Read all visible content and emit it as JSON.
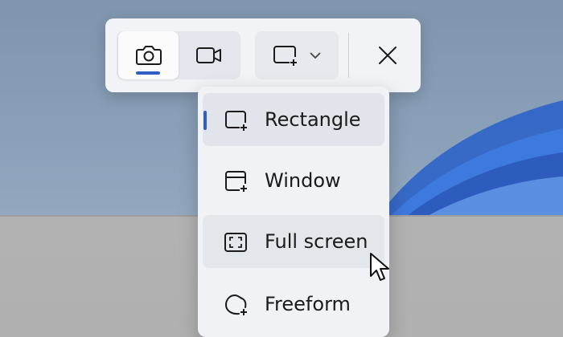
{
  "toolbar": {
    "modes": [
      {
        "name": "screenshot",
        "icon": "camera-icon",
        "active": true
      },
      {
        "name": "record",
        "icon": "video-camera-icon",
        "active": false
      }
    ],
    "shape_dropdown_icon": "rectangle-snip-icon",
    "chevron_icon": "chevron-down-icon",
    "close_icon": "close-icon"
  },
  "menu": {
    "items": [
      {
        "label": "Rectangle",
        "icon": "rectangle-snip-icon",
        "selected": true
      },
      {
        "label": "Window",
        "icon": "window-snip-icon",
        "selected": false
      },
      {
        "label": "Full screen",
        "icon": "fullscreen-snip-icon",
        "selected": false,
        "hovered": true
      },
      {
        "label": "Freeform",
        "icon": "freeform-snip-icon",
        "selected": false
      }
    ]
  },
  "colors": {
    "accent": "#2f5fc4",
    "panel": "#f1f3f7",
    "text": "#1b1b1b"
  }
}
